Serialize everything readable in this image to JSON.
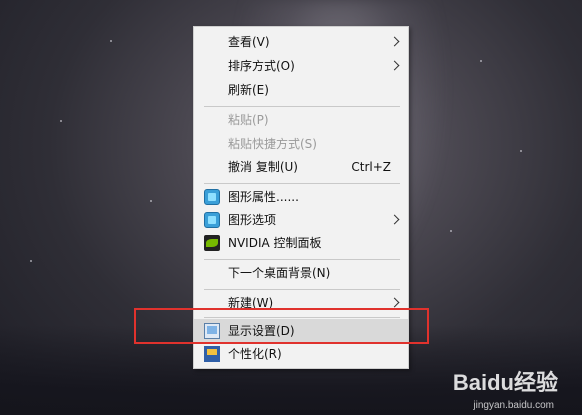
{
  "context_menu": {
    "items": [
      {
        "label": "查看(V)",
        "submenu": true
      },
      {
        "label": "排序方式(O)",
        "submenu": true
      },
      {
        "label": "刷新(E)"
      },
      {
        "label": "粘贴(P)",
        "disabled": true
      },
      {
        "label": "粘贴快捷方式(S)",
        "disabled": true
      },
      {
        "label": "撤消 复制(U)",
        "shortcut": "Ctrl+Z"
      },
      {
        "label": "图形属性......",
        "icon": "intel-graphics-icon"
      },
      {
        "label": "图形选项",
        "icon": "intel-graphics-icon",
        "submenu": true
      },
      {
        "label": "NVIDIA 控制面板",
        "icon": "nvidia-icon"
      },
      {
        "label": "下一个桌面背景(N)"
      },
      {
        "label": "新建(W)",
        "submenu": true
      },
      {
        "label": "显示设置(D)",
        "icon": "display-settings-icon",
        "highlighted": true
      },
      {
        "label": "个性化(R)",
        "icon": "personalize-icon"
      }
    ]
  },
  "annotation": {
    "color": "#e0322d"
  },
  "watermark": {
    "brand": "Baidu经验",
    "url": "jingyan.baidu.com"
  }
}
